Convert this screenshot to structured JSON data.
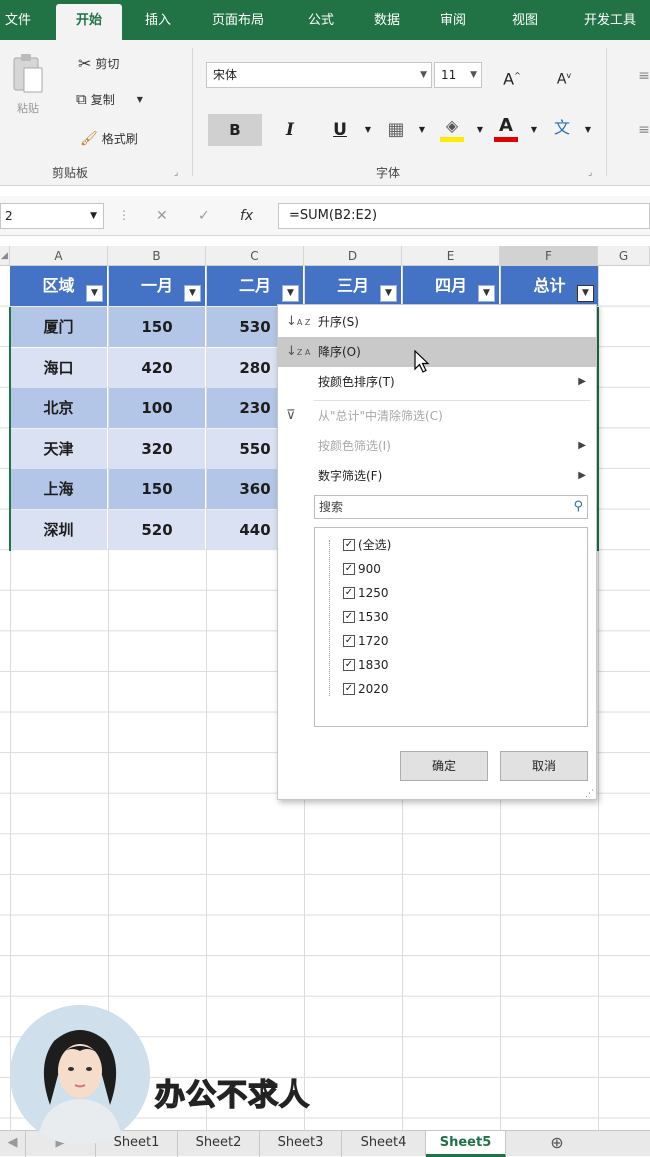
{
  "ribbon_tabs": [
    "文件",
    "开始",
    "插入",
    "页面布局",
    "公式",
    "数据",
    "审阅",
    "视图",
    "开发工具"
  ],
  "active_tab": "开始",
  "clipboard": {
    "paste_label": "粘贴",
    "cut_label": "剪切",
    "copy_label": "复制",
    "format_painter_label": "格式刷",
    "group_label": "剪贴板"
  },
  "font": {
    "font_name": "宋体",
    "font_size": "11",
    "group_label": "字体",
    "bold": "B",
    "italic": "I",
    "underline": "U"
  },
  "formula_bar": {
    "name_box": "2",
    "formula": "=SUM(B2:E2)"
  },
  "column_headers": [
    "A",
    "B",
    "C",
    "D",
    "E",
    "F",
    "G"
  ],
  "table": {
    "headers": [
      "区域",
      "一月",
      "二月",
      "三月",
      "四月",
      "总计"
    ],
    "rows": [
      [
        "厦门",
        "150",
        "530"
      ],
      [
        "海口",
        "420",
        "280"
      ],
      [
        "北京",
        "100",
        "230"
      ],
      [
        "天津",
        "320",
        "550"
      ],
      [
        "上海",
        "150",
        "360"
      ],
      [
        "深圳",
        "520",
        "440"
      ]
    ]
  },
  "filter_menu": {
    "items": [
      {
        "label": "升序(S)",
        "icon": "sort-ascending-icon",
        "state": "normal"
      },
      {
        "label": "降序(O)",
        "icon": "sort-descending-icon",
        "state": "highlighted"
      },
      {
        "label": "按颜色排序(T)",
        "state": "normal",
        "submenu": true
      },
      {
        "label": "从\"总计\"中清除筛选(C)",
        "icon": "clear-filter-icon",
        "state": "disabled"
      },
      {
        "label": "按颜色筛选(I)",
        "state": "disabled",
        "submenu": true
      },
      {
        "label": "数字筛选(F)",
        "state": "normal",
        "submenu": true
      }
    ],
    "search_placeholder": "搜索",
    "checklist": [
      "(全选)",
      "900",
      "1250",
      "1530",
      "1720",
      "1830",
      "2020"
    ],
    "ok_label": "确定",
    "cancel_label": "取消"
  },
  "sheet_tabs": [
    "Sheet1",
    "Sheet2",
    "Sheet3",
    "Sheet4",
    "Sheet5"
  ],
  "active_sheet": "Sheet5",
  "watermark": "办公不求人",
  "colors": {
    "excel_green": "#217346",
    "table_header": "#4472c4",
    "band_dark": "#b4c6e7",
    "band_light": "#d9e1f2"
  }
}
